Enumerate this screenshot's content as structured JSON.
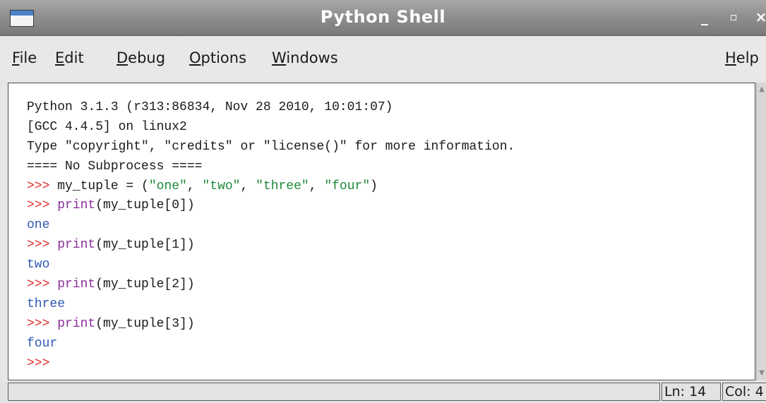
{
  "window": {
    "title": "Python Shell",
    "controls": {
      "minimize": "_",
      "maximize": "▫",
      "close": "×"
    }
  },
  "menu": {
    "file": {
      "accel": "F",
      "rest": "ile"
    },
    "edit": {
      "accel": "E",
      "rest": "dit"
    },
    "debug": {
      "accel": "D",
      "rest": "ebug"
    },
    "options": {
      "accel": "O",
      "rest": "ptions"
    },
    "windows": {
      "accel": "W",
      "rest": "indows"
    },
    "help": {
      "accel": "H",
      "rest": "elp"
    }
  },
  "shell": {
    "banner": [
      "Python 3.1.3 (r313:86834, Nov 28 2010, 10:01:07)",
      "[GCC 4.4.5] on linux2",
      "Type \"copyright\", \"credits\" or \"license()\" for more information.",
      "==== No Subprocess ===="
    ],
    "prompt": ">>>",
    "cmd1": {
      "before": " my_tuple = (",
      "s1": "\"one\"",
      "sep1": ", ",
      "s2": "\"two\"",
      "sep2": ", ",
      "s3": "\"three\"",
      "sep3": ", ",
      "s4": "\"four\"",
      "after": ")"
    },
    "print_kw": " print",
    "calls": [
      {
        "args": "(my_tuple[0])",
        "output": "one"
      },
      {
        "args": "(my_tuple[1])",
        "output": "two"
      },
      {
        "args": "(my_tuple[2])",
        "output": "three"
      },
      {
        "args": "(my_tuple[3])",
        "output": "four"
      }
    ]
  },
  "status": {
    "ln": "Ln: 14",
    "col": "Col: 4"
  },
  "colors": {
    "prompt": "#e02b2b",
    "keyword": "#8a2f9a",
    "string": "#1f8a3a",
    "output": "#2f59b5"
  }
}
